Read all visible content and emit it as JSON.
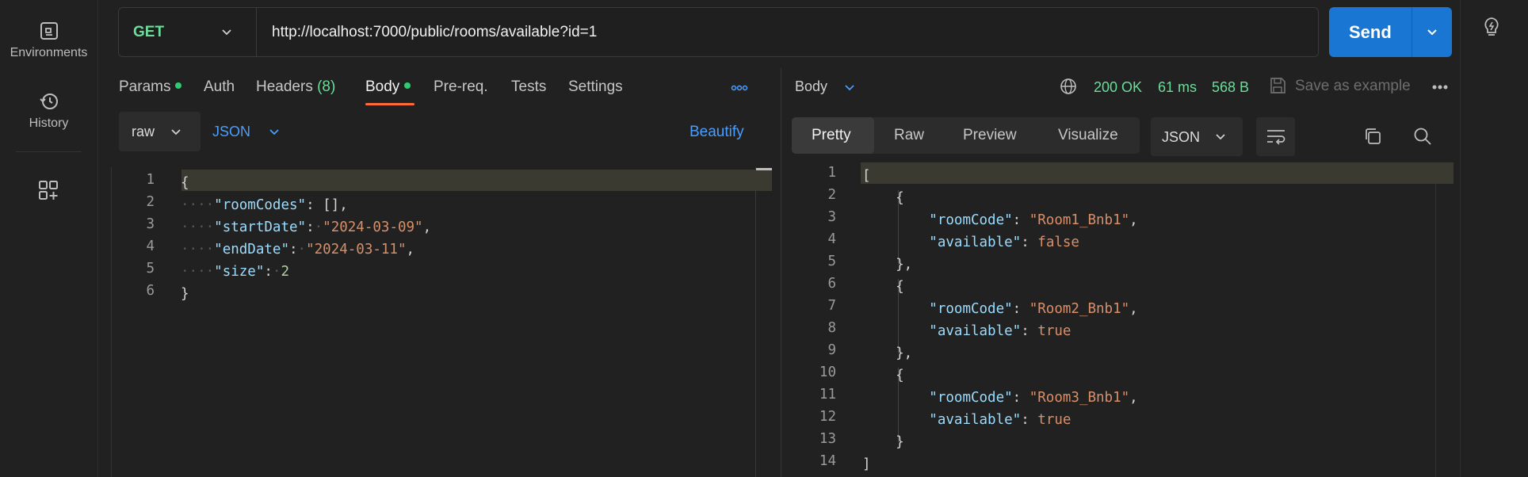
{
  "rail": {
    "environments_label": "Environments",
    "history_label": "History"
  },
  "request": {
    "method": "GET",
    "url": "http://localhost:7000/public/rooms/available?id=1",
    "send_label": "Send"
  },
  "request_tabs": {
    "params": "Params",
    "auth": "Auth",
    "headers": "Headers",
    "headers_count": "(8)",
    "body": "Body",
    "prereq": "Pre-req.",
    "tests": "Tests",
    "settings": "Settings"
  },
  "body_options": {
    "mode": "raw",
    "language": "JSON",
    "beautify": "Beautify"
  },
  "request_body": {
    "line_numbers": [
      "1",
      "2",
      "3",
      "4",
      "5",
      "6"
    ]
  },
  "response": {
    "label": "Body",
    "status": "200 OK",
    "time": "61 ms",
    "size": "568 B",
    "save_example": "Save as example",
    "view_tabs": [
      "Pretty",
      "Raw",
      "Preview",
      "Visualize"
    ],
    "language": "JSON",
    "line_numbers": [
      "1",
      "2",
      "3",
      "4",
      "5",
      "6",
      "7",
      "8",
      "9",
      "10",
      "11",
      "12",
      "13",
      "14"
    ]
  },
  "colors": {
    "accent_orange": "#ff6c37",
    "send_blue": "#1976d2",
    "status_green": "#6bdd9a",
    "link_blue": "#4a9eff"
  }
}
